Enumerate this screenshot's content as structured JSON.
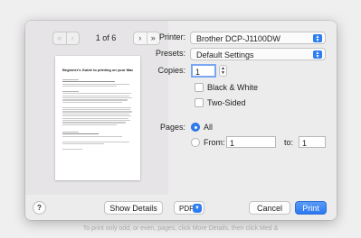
{
  "preview": {
    "prev_first": "«",
    "prev": "‹",
    "page_indicator": "1 of 6",
    "next": "›",
    "next_last": "»",
    "doc_title": "Beginner's Guide to printing on your Mac, iPhone and iPad"
  },
  "settings": {
    "printer_label": "Printer:",
    "printer_value": "Brother DCP-J1100DW",
    "presets_label": "Presets:",
    "presets_value": "Default Settings",
    "copies_label": "Copies:",
    "copies_value": "1",
    "black_white_label": "Black & White",
    "two_sided_label": "Two-Sided",
    "pages_label": "Pages:",
    "all_label": "All",
    "from_label": "From:",
    "from_value": "1",
    "to_label": "to:",
    "to_value": "1"
  },
  "footer": {
    "help": "?",
    "show_details": "Show Details",
    "pdf": "PDF",
    "cancel": "Cancel",
    "print": "Print"
  },
  "caption": "To print only odd, or even, pages, click More Details, then click Med &",
  "colors": {
    "accent": "#2e7ef1"
  }
}
